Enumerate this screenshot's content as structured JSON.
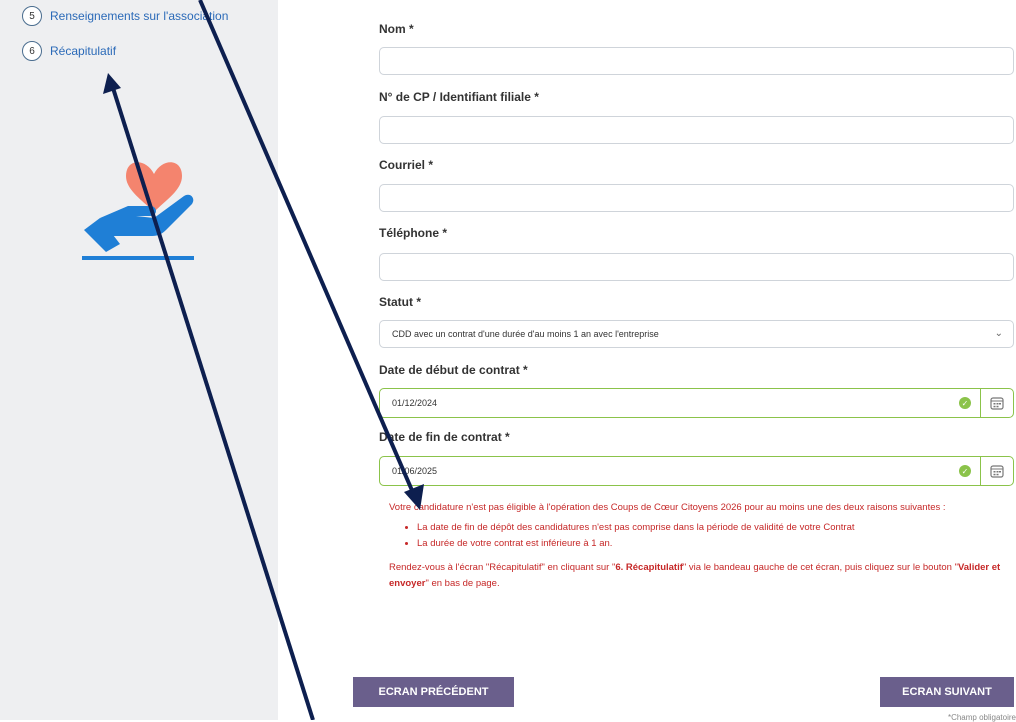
{
  "sidebar": {
    "steps": [
      {
        "num": "5",
        "label": "Renseignements sur l'association"
      },
      {
        "num": "6",
        "label": "Récapitulatif"
      }
    ]
  },
  "form": {
    "nom_label": "Nom *",
    "cp_label": "N° de CP / Identifiant filiale *",
    "courriel_label": "Courriel *",
    "telephone_label": "Téléphone *",
    "statut_label": "Statut *",
    "statut_value": "CDD avec un contrat d'une durée d'au moins 1 an avec l'entreprise",
    "date_debut_label": "Date de début de contrat *",
    "date_debut_value": "01/12/2024",
    "date_fin_label": "Date de fin de contrat *",
    "date_fin_value": "01/06/2025"
  },
  "error": {
    "intro": "Votre candidature n'est pas éligible à l'opération des Coups de Cœur Citoyens 2026 pour au moins une des deux raisons suivantes :",
    "reasons": [
      "La date de fin de dépôt des candidatures n'est pas comprise dans la période de validité de votre Contrat",
      "La durée de votre contrat est inférieure à 1 an."
    ],
    "instr_1": "Rendez-vous à l'écran \"Récapitulatif\" en cliquant sur \"",
    "instr_bold_1": "6. Récapitulatif",
    "instr_2": "\" via le bandeau gauche de cet écran, puis cliquez sur le bouton \"",
    "instr_bold_2": "Valider et envoyer",
    "instr_3": "\" en bas de page."
  },
  "buttons": {
    "prev": "ECRAN PRÉCÉDENT",
    "next": "ECRAN SUIVANT"
  },
  "footnote": "*Champ obligatoire",
  "colors": {
    "accent": "#2b6ab8",
    "button": "#6a5f8c",
    "error": "#c62828",
    "valid": "#8bc34a",
    "annotation_arrow": "#0d1f4f"
  }
}
